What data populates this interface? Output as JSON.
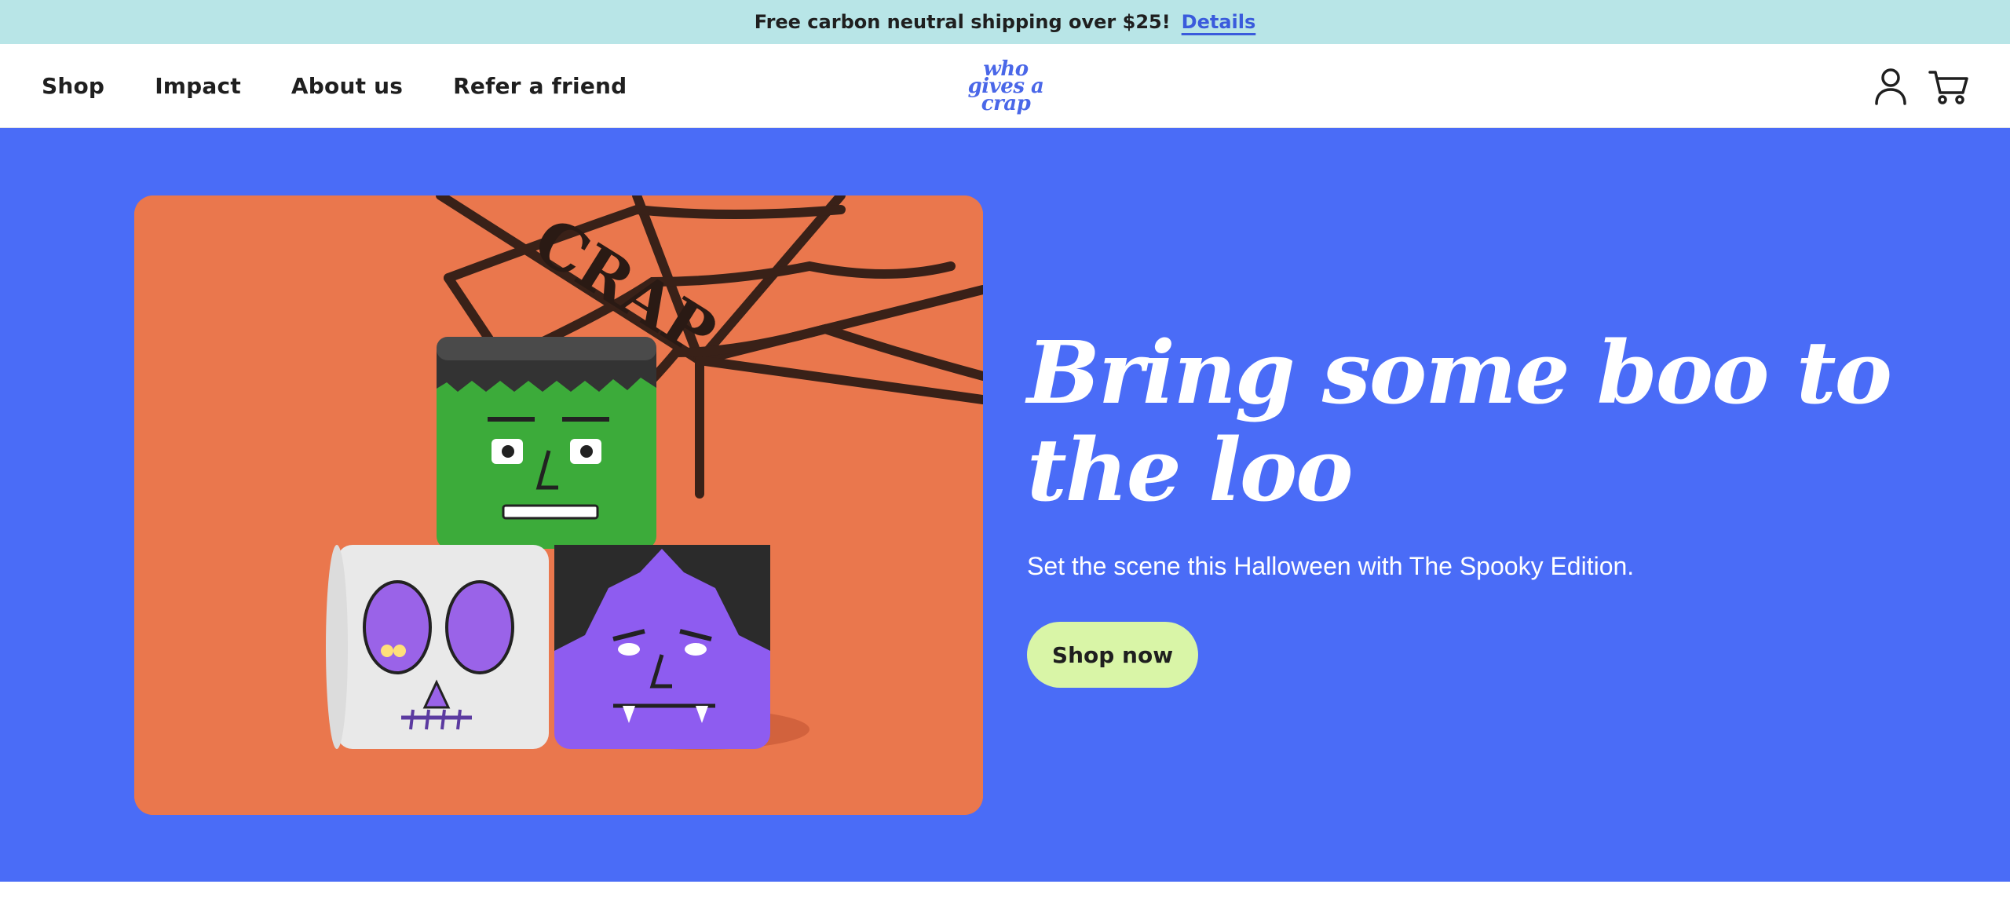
{
  "announcement": {
    "text": "Free carbon neutral shipping over $25!",
    "link_label": "Details"
  },
  "nav": {
    "items": [
      {
        "label": "Shop"
      },
      {
        "label": "Impact"
      },
      {
        "label": "About us"
      },
      {
        "label": "Refer a friend"
      }
    ]
  },
  "logo": {
    "line1": "who",
    "line2": "gives a",
    "line3": "crap"
  },
  "header_icons": {
    "account": "user-icon",
    "cart": "cart-icon"
  },
  "hero": {
    "title": "Bring some boo to the loo",
    "subtitle": "Set the scene this Halloween with The Spooky Edition.",
    "cta_label": "Shop now",
    "image_text": "CRAP"
  },
  "colors": {
    "announcement_bg": "#b8e5e7",
    "hero_bg": "#4a6cf7",
    "brand_blue": "#4a67e8",
    "cta_bg": "#d9f5a7",
    "image_bg": "#ea774d"
  }
}
